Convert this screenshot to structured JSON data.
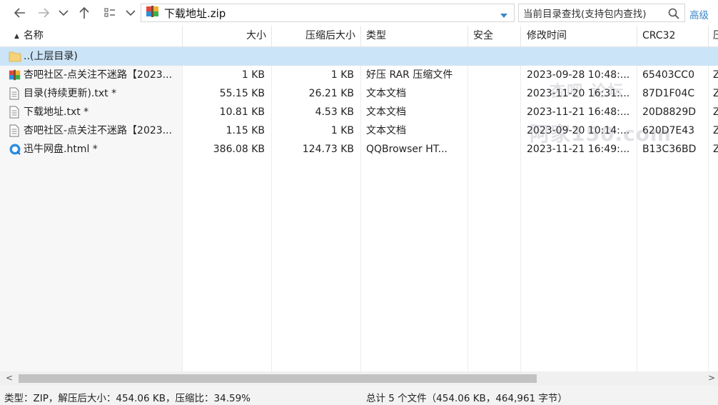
{
  "address": {
    "path": "下载地址.zip"
  },
  "search": {
    "placeholder": "当前目录查找(支持包内查找)",
    "advanced": "高级"
  },
  "columns": {
    "name": "名称",
    "size": "大小",
    "packed": "压缩后大小",
    "type": "类型",
    "security": "安全",
    "modified": "修改时间",
    "crc": "CRC32",
    "extra": "压"
  },
  "parent_row": {
    "name": "..(上层目录)"
  },
  "files": [
    {
      "name": "杏吧社区-点关注不迷路【2023...",
      "size": "1 KB",
      "packed": "1 KB",
      "type": "好压 RAR 压缩文件",
      "security": "",
      "modified": "2023-09-28 10:48:...",
      "crc": "65403CC0",
      "extra": "Z",
      "icon": "rar-archive-icon"
    },
    {
      "name": "目录(持续更新).txt *",
      "size": "55.15 KB",
      "packed": "26.21 KB",
      "type": "文本文档",
      "security": "",
      "modified": "2023-11-20 16:31:...",
      "crc": "87D1F04C",
      "extra": "Z",
      "icon": "text-file-icon"
    },
    {
      "name": "下载地址.txt *",
      "size": "10.81 KB",
      "packed": "4.53 KB",
      "type": "文本文档",
      "security": "",
      "modified": "2023-11-21 16:48:...",
      "crc": "20D8829D",
      "extra": "Z",
      "icon": "text-file-icon"
    },
    {
      "name": "杏吧社区-点关注不迷路【2023...",
      "size": "1.15 KB",
      "packed": "1 KB",
      "type": "文本文档",
      "security": "",
      "modified": "2023-09-20 10:14:...",
      "crc": "620D7E43",
      "extra": "Z",
      "icon": "text-file-icon"
    },
    {
      "name": "迅牛网盘.html *",
      "size": "386.08 KB",
      "packed": "124.73 KB",
      "type": "QQBrowser HT...",
      "security": "",
      "modified": "2023-11-21 16:49:...",
      "crc": "B13C36BD",
      "extra": "Z",
      "icon": "browser-html-icon"
    }
  ],
  "watermark": {
    "line1": "杏吧 论坛",
    "line2": "阿家150.com"
  },
  "status": {
    "left": "类型：ZIP，解压后大小：454.06 KB，压缩比：34.59%",
    "right": "总计 5 个文件（454.06 KB，464,961 字节）"
  },
  "colors": {
    "selection": "#cce4f7",
    "accent": "#3a86c8",
    "status_bg": "#f3f3f3"
  }
}
